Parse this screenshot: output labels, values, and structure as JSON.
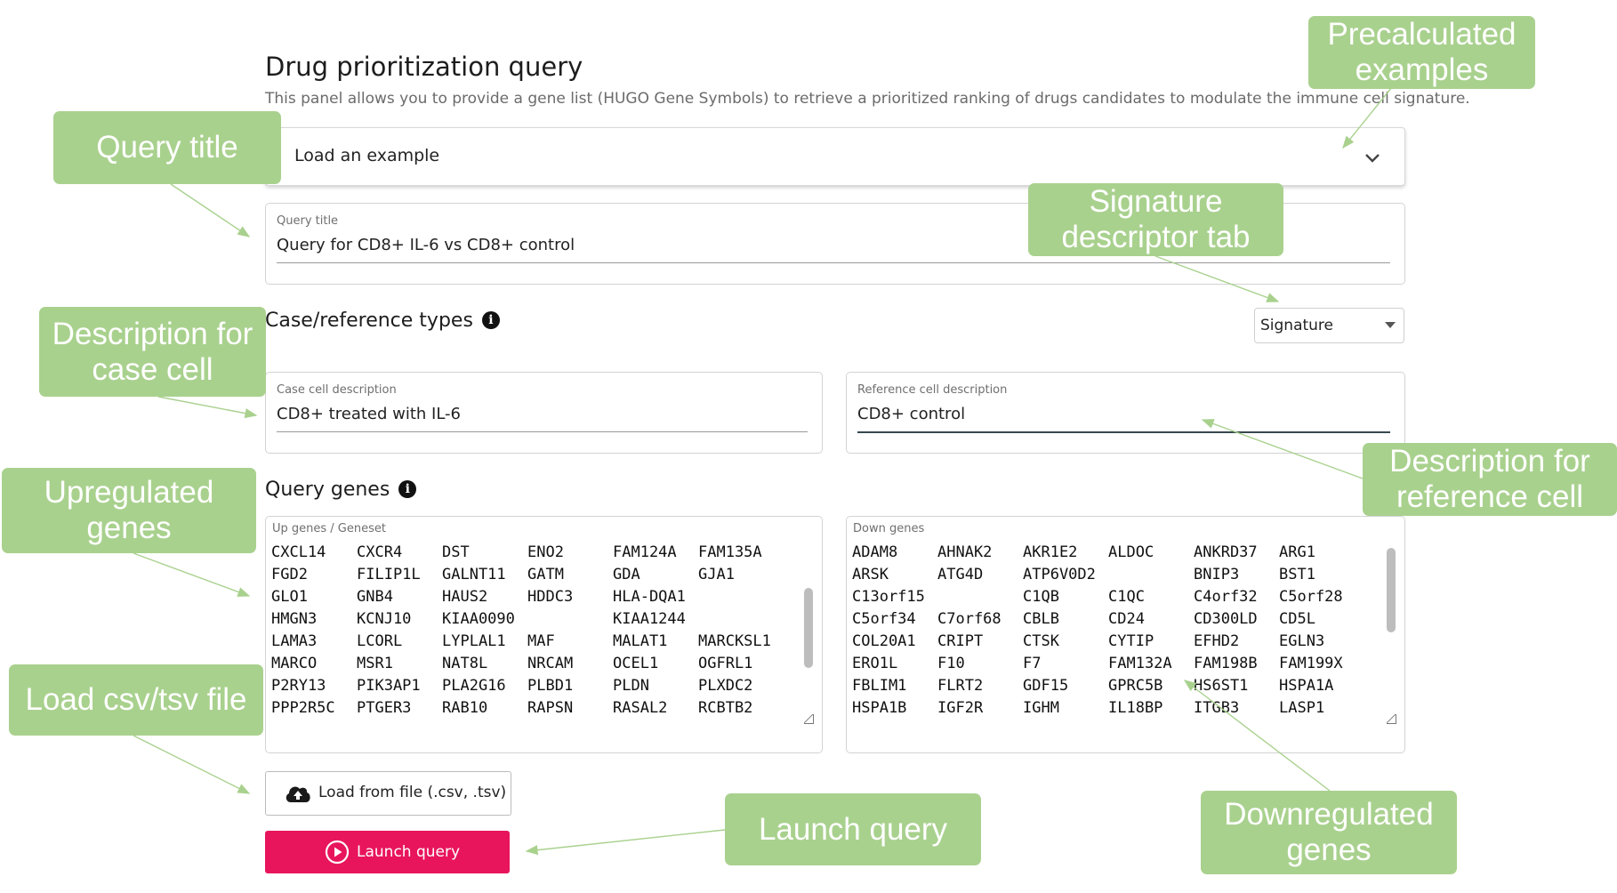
{
  "page": {
    "title": "Drug prioritization query",
    "subtitle": "This panel allows you to provide a gene list (HUGO Gene Symbols) to retrieve a prioritized ranking of drugs candidates to modulate the immune cell signature."
  },
  "example_select": {
    "value": "Load an example",
    "icon": "chevron-down-icon"
  },
  "query_title": {
    "label": "Query title",
    "value": "Query for CD8+ IL-6 vs CD8+ control"
  },
  "case_reference": {
    "heading": "Case/reference types",
    "info_icon": "info-icon",
    "descriptor_select": "Signature",
    "case": {
      "label": "Case cell description",
      "value": "CD8+ treated with IL-6"
    },
    "reference": {
      "label": "Reference cell description",
      "value": "CD8+ control"
    }
  },
  "query_genes": {
    "heading": "Query genes",
    "up": {
      "label": "Up genes / Geneset",
      "genes": [
        "CXCL14",
        "CXCR4",
        "DST",
        "ENO2",
        "FAM124A",
        "FAM135A",
        "FGD2",
        "FILIP1L",
        "GALNT11",
        "GATM",
        "GDA",
        "GJA1",
        "GLO1",
        "GNB4",
        "HAUS2",
        "HDDC3",
        "HLA-DQA1",
        "",
        "HMGN3",
        "KCNJ10",
        "KIAA0090",
        "",
        "KIAA1244",
        "",
        "LAMA3",
        "LCORL",
        "LYPLAL1",
        "MAF",
        "MALAT1",
        "MARCKSL1",
        "MARCO",
        "MSR1",
        "NAT8L",
        "NRCAM",
        "OCEL1",
        "OGFRL1",
        "P2RY13",
        "PIK3AP1",
        "PLA2G16",
        "PLBD1",
        "PLDN",
        "PLXDC2",
        "PPP2R5C",
        "PTGER3",
        "RAB10",
        "RAPSN",
        "RASAL2",
        "RCBTB2"
      ]
    },
    "down": {
      "label": "Down genes",
      "genes": [
        "ADAM8",
        "AHNAK2",
        "AKR1E2",
        "ALDOC",
        "ANKRD37",
        "ARG1",
        "ARSK",
        "ATG4D",
        "ATP6V0D2",
        "",
        "BNIP3",
        "BST1",
        "C13orf15",
        "",
        "C1QB",
        "C1QC",
        "C4orf32",
        "C5orf28",
        "C5orf34",
        "C7orf68",
        "CBLB",
        "CD24",
        "CD300LD",
        "CD5L",
        "COL20A1",
        "CRIPT",
        "CTSK",
        "CYTIP",
        "EFHD2",
        "EGLN3",
        "ERO1L",
        "F10",
        "F7",
        "FAM132A",
        "FAM198B",
        "FAM199X",
        "FBLIM1",
        "FLRT2",
        "GDF15",
        "GPRC5B",
        "HS6ST1",
        "HSPA1A",
        "HSPA1B",
        "IGF2R",
        "IGHM",
        "IL18BP",
        "ITGB3",
        "LASP1"
      ]
    }
  },
  "actions": {
    "load_file": "Load from file (.csv, .tsv)",
    "load_file_icon": "cloud-upload-icon",
    "launch": "Launch query",
    "launch_icon": "play-circle-icon"
  },
  "callouts": {
    "precalculated": "Precalculated examples",
    "query_title": "Query title",
    "signature_tab": "Signature descriptor tab",
    "case_cell": "Description for case cell",
    "reference_cell": "Description for reference cell",
    "upregulated": "Upregulated genes",
    "load_file": "Load csv/tsv file",
    "launch": "Launch query",
    "downregulated": "Downregulated genes"
  },
  "colors": {
    "callout": "#a9d18e",
    "launch": "#e8155c"
  }
}
